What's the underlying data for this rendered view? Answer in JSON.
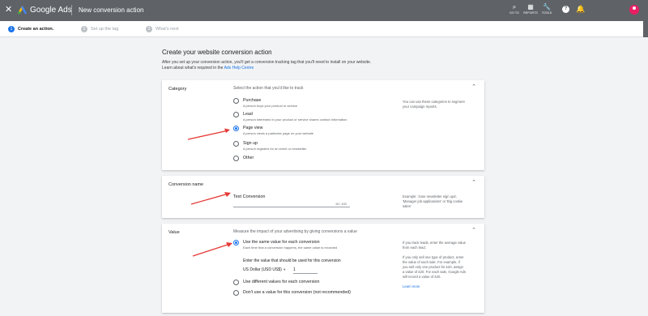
{
  "header": {
    "close_glyph": "✕",
    "brand": "Google Ads",
    "title": "New conversion action",
    "tools": [
      {
        "label": "GO TO",
        "icon": "search-icon",
        "glyph": "⌕"
      },
      {
        "label": "REPORTS",
        "icon": "reports-icon",
        "glyph": "▦"
      },
      {
        "label": "TOOLS",
        "icon": "wrench-icon",
        "glyph": "🔧"
      }
    ],
    "help_glyph": "?",
    "bell_glyph": "🔔"
  },
  "stepper": {
    "steps": [
      {
        "num": "1",
        "label": "Create an action.",
        "state": "active"
      },
      {
        "num": "2",
        "label": "Set up the tag",
        "state": "inactive"
      },
      {
        "num": "3",
        "label": "What's next",
        "state": "inactive"
      }
    ]
  },
  "main": {
    "heading": "Create your website conversion action",
    "intro_line1": "After you set up your conversion action, you'll get a conversion tracking tag that you'll need to install on your website.",
    "intro_line2": "Learn about what's required in the",
    "intro_link": "Ads Help Centre"
  },
  "category": {
    "label": "Category",
    "description": "Select the action that you'd like to track",
    "help": "You can use these categories to segment your campaign reports.",
    "options": [
      {
        "title": "Purchase",
        "sub": "A person buys your product or service",
        "selected": false
      },
      {
        "title": "Lead",
        "sub": "A person interested in your product or service shares contact information",
        "selected": false
      },
      {
        "title": "Page view",
        "sub": "A person views a particular page on your website",
        "selected": true
      },
      {
        "title": "Sign up",
        "sub": "A person registers for an event or newsletter",
        "selected": false
      },
      {
        "title": "Other",
        "sub": "",
        "selected": false
      }
    ]
  },
  "conversion_name": {
    "label": "Conversion name",
    "value": "Test Conversion",
    "counter": "15 / 100",
    "help": "Example: 'June newsletter sign ups', 'Manager job applications' or 'Big cookie sales'"
  },
  "value": {
    "label": "Value",
    "description": "Measure the impact of your advertising by giving conversions a value",
    "options": [
      {
        "title": "Use the same value for each conversion",
        "sub": "Each time that a conversion happens, the same value is recorded",
        "selected": true
      },
      {
        "title": "Use different values for each conversion",
        "sub": "",
        "selected": false
      },
      {
        "title": "Don't use a value for this conversion (not recommended)",
        "sub": "",
        "selected": false
      }
    ],
    "enter_label": "Enter the value that should be used for this conversion",
    "currency": "US Dollar (USD US$)",
    "currency_arrow": "▼",
    "amount": "1",
    "help1": "If you track leads, enter the average value from each lead.",
    "help2": "If you only sell one type of product, enter the value of each sale. For example, if you sell only one product for £20, assign a value of £20. For each sale, Google Ads will record a value of £20.",
    "help_link": "Learn more"
  },
  "chevron_glyph": "⌃",
  "colors": {
    "topbar": "#5f6368",
    "accent": "#1a73e8",
    "arrow": "#e53935",
    "avatar": "#e91e63"
  }
}
